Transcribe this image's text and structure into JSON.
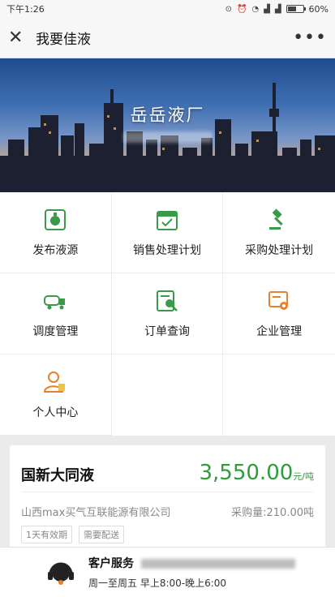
{
  "status_bar": {
    "time": "下午1:26",
    "battery": "60%",
    "battery_level": 0.6
  },
  "navbar": {
    "title": "我要佳液",
    "more": "•••"
  },
  "banner": {
    "company_name": "岳岳液厂"
  },
  "menu": [
    {
      "label": "发布液源",
      "icon": "publish-gas-icon"
    },
    {
      "label": "销售处理计划",
      "icon": "calendar-icon"
    },
    {
      "label": "采购处理计划",
      "icon": "gavel-icon"
    },
    {
      "label": "调度管理",
      "icon": "tanker-truck-icon"
    },
    {
      "label": "订单查询",
      "icon": "search-order-icon"
    },
    {
      "label": "企业管理",
      "icon": "gear-certificate-icon"
    },
    {
      "label": "个人中心",
      "icon": "user-icon"
    }
  ],
  "listing": {
    "product": "国新大同液",
    "price": "3,550.00",
    "price_unit": "元/吨",
    "company": "山西max买气互联能源有限公司",
    "purchase": "采购量:210.00吨",
    "tags": [
      "1天有效期",
      "需要配送"
    ]
  },
  "service": {
    "title": "客户服务",
    "hours": "周一至周五 早上8:00-晚上6:00"
  },
  "colors": {
    "accent": "#2e9c3a",
    "icon_green": "#3a9a4a",
    "icon_orange": "#e8812b"
  }
}
